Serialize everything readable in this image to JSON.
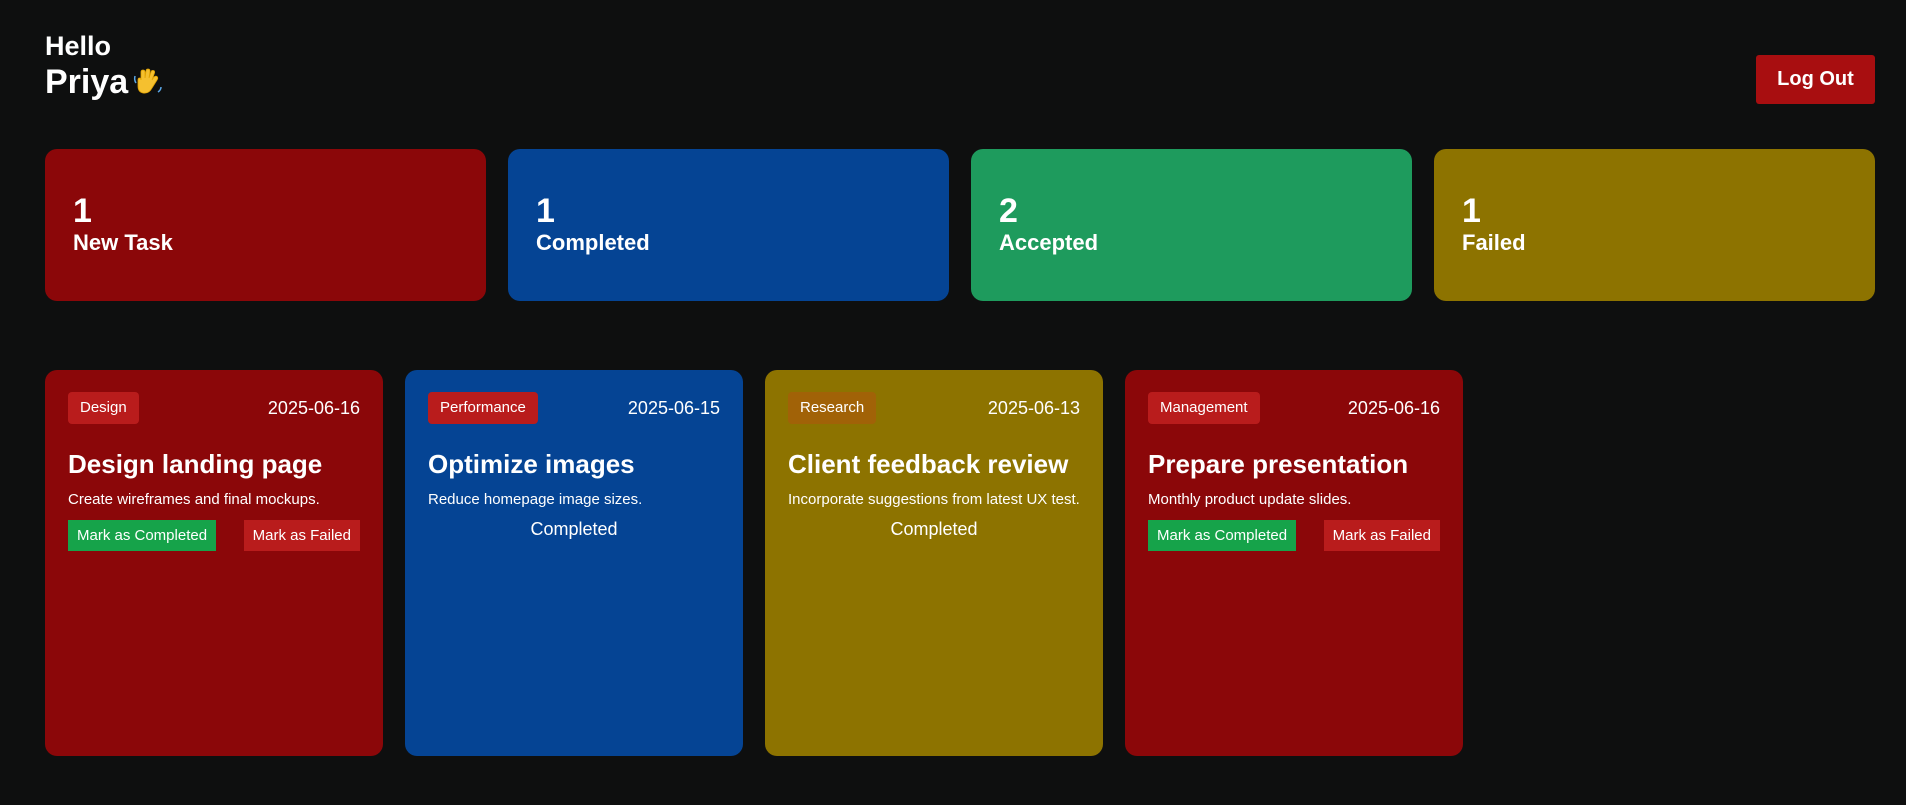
{
  "header": {
    "greeting": "Hello",
    "username": "Priya",
    "wave_icon": "waving-hand-icon",
    "logout_label": "Log Out"
  },
  "colors": {
    "background": "#0e0f0f",
    "red": "#8b0709",
    "blue": "#054494",
    "green": "#1e9b5d",
    "yellow": "#8d7300",
    "logout": "#a80e10"
  },
  "stats": [
    {
      "count": "1",
      "label": "New Task",
      "color": "#8b0709"
    },
    {
      "count": "1",
      "label": "Completed",
      "color": "#054494"
    },
    {
      "count": "2",
      "label": "Accepted",
      "color": "#1e9b5d"
    },
    {
      "count": "1",
      "label": "Failed",
      "color": "#8d7300"
    }
  ],
  "tasks": [
    {
      "category": "Design",
      "date": "2025-06-16",
      "title": "Design landing page",
      "description": "Create wireframes and final mockups.",
      "complete_label": "Mark as Completed",
      "fail_label": "Mark as Failed",
      "color": "#8b0709",
      "tag_color": "#b91c1c"
    },
    {
      "category": "Performance",
      "date": "2025-06-15",
      "title": "Optimize images",
      "description": "Reduce homepage image sizes.",
      "status": "Completed",
      "color": "#054494",
      "tag_color": "#b91c1c"
    },
    {
      "category": "Research",
      "date": "2025-06-13",
      "title": "Client feedback review",
      "description": "Incorporate suggestions from latest UX test.",
      "status": "Completed",
      "color": "#8d7300",
      "tag_color": "#a16207"
    },
    {
      "category": "Management",
      "date": "2025-06-16",
      "title": "Prepare presentation",
      "description": "Monthly product update slides.",
      "complete_label": "Mark as Completed",
      "fail_label": "Mark as Failed",
      "color": "#8b0709",
      "tag_color": "#b91c1c"
    }
  ]
}
